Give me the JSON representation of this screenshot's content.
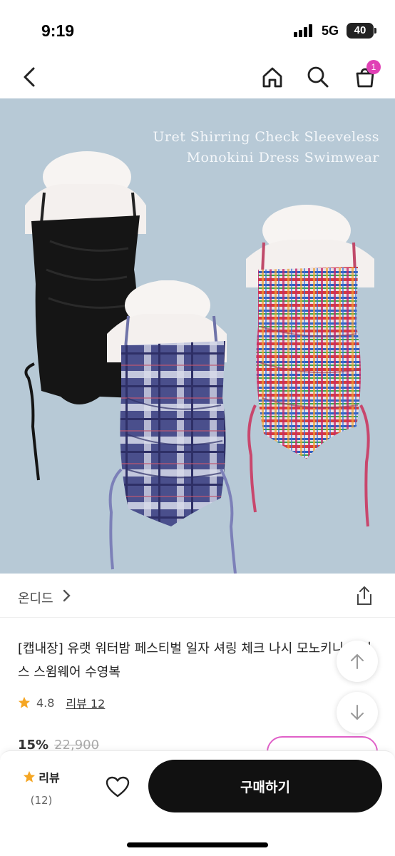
{
  "status_bar": {
    "time": "9:19",
    "network": "5G",
    "battery": "40"
  },
  "nav": {
    "cart_count": "1"
  },
  "product_image": {
    "caption_line1": "Uret Shirring Check Sleeveless",
    "caption_line2": "Monokini Dress Swimwear",
    "background_color": "#b7c9d6"
  },
  "brand": {
    "name": "온디드"
  },
  "product": {
    "title": "[캡내장] 유랫 워터밤 페스티벌 일자 셔링 체크 나시 모노키니 원피스 스윔웨어 수영복",
    "rating": "4.8",
    "review_link": "리뷰 12",
    "discount_rate": "15%",
    "original_price": "22,900"
  },
  "bottom_bar": {
    "review_label": "리뷰",
    "review_count": "(12)",
    "buy_label": "구매하기"
  },
  "colors": {
    "accent": "#e040b5",
    "star": "#f5a623",
    "button": "#111111"
  }
}
